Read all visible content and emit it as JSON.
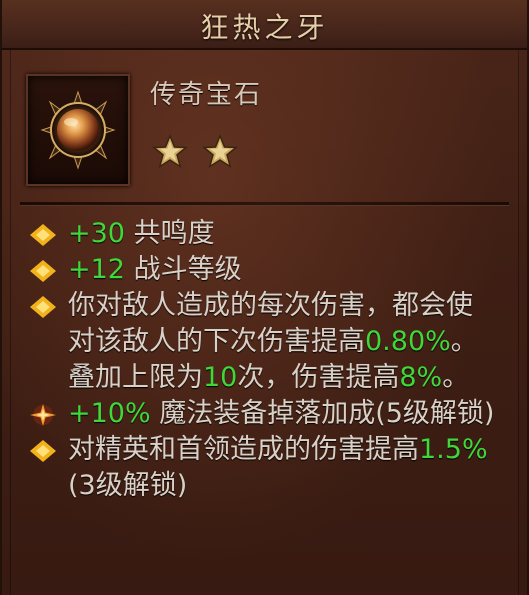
{
  "item": {
    "name": "狂热之牙",
    "type": "传奇宝石",
    "rank_stars": 2
  },
  "icons": {
    "gem": "legendary-gem-icon",
    "star": "rank-star-icon",
    "bullet": "diamond-bullet-icon",
    "bullet_special": "sparkle-bullet-icon"
  },
  "colors": {
    "title": "#e6cfa8",
    "text": "#d9d1c8",
    "highlight": "#3fd83a",
    "bullet": "#f2b21b"
  },
  "properties": [
    {
      "value": "+30",
      "text": " 共鸣度"
    },
    {
      "value": "+12",
      "text": " 战斗等级"
    },
    {
      "text_a": "你对敌人造成的每次伤害，都会使对该敌人的下次伤害提高",
      "value_a": "0.80%",
      "text_b": "。叠加上限为",
      "value_b": "10",
      "text_c": "次，伤害提高",
      "value_c": "8%",
      "text_d": "。"
    },
    {
      "value": "+10%",
      "text": " 魔法装备掉落加成(5级解锁)"
    },
    {
      "text_a": "对精英和首领造成的伤害提高",
      "value_a": "1.5%",
      "text_b": "(3级解锁)"
    }
  ]
}
